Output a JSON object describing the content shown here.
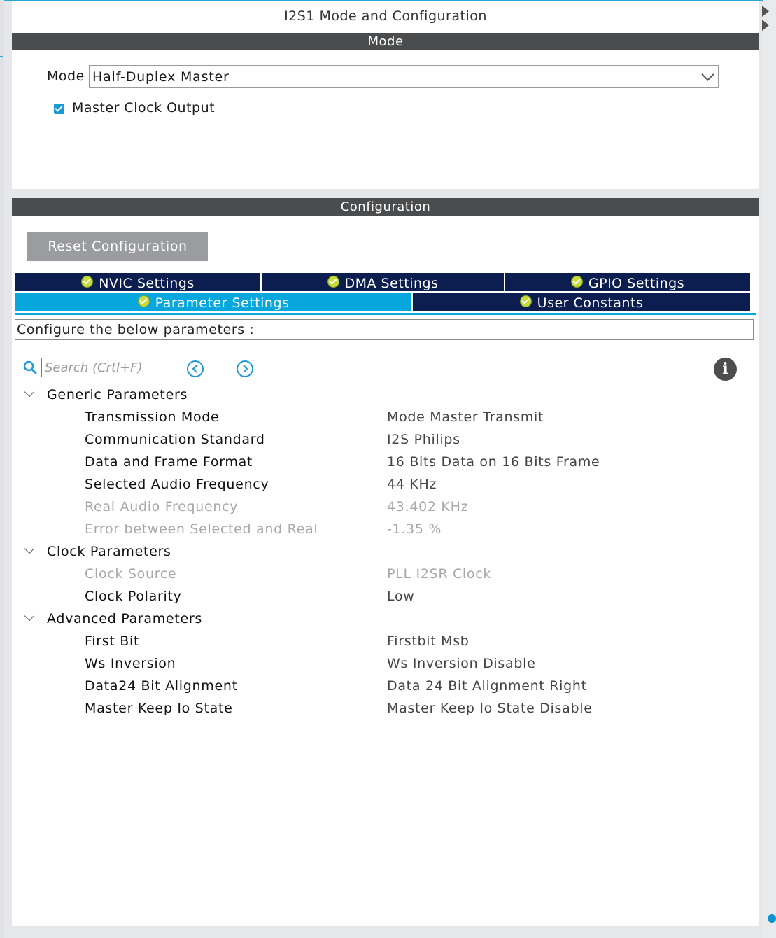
{
  "window": {
    "title": "I2S1 Mode and Configuration"
  },
  "mode_section": {
    "header": "Mode",
    "mode_label": "Mode",
    "mode_value": "Half-Duplex Master",
    "master_clock_output_label": "Master Clock Output",
    "master_clock_output_checked": true
  },
  "config_section": {
    "header": "Configuration",
    "reset_button": "Reset Configuration",
    "tabs_row1": [
      {
        "label": "NVIC Settings"
      },
      {
        "label": "DMA Settings"
      },
      {
        "label": "GPIO Settings"
      }
    ],
    "tabs_row2": [
      {
        "label": "Parameter Settings",
        "active": true
      },
      {
        "label": "User Constants"
      }
    ],
    "description": "Configure the below parameters :",
    "search_placeholder": "Search (Crtl+F)",
    "info_icon": "i"
  },
  "parameters": {
    "generic": {
      "title": "Generic Parameters",
      "items": [
        {
          "name": "Transmission Mode",
          "value": "Mode Master Transmit"
        },
        {
          "name": "Communication Standard",
          "value": "I2S Philips"
        },
        {
          "name": "Data and Frame Format",
          "value": "16 Bits Data on 16 Bits Frame"
        },
        {
          "name": "Selected Audio Frequency",
          "value": "44 KHz"
        },
        {
          "name": "Real Audio Frequency",
          "value": "43.402 KHz"
        },
        {
          "name": "Error between Selected and Real",
          "value": "-1.35 %"
        }
      ]
    },
    "clock": {
      "title": "Clock Parameters",
      "items": [
        {
          "name": "Clock Source",
          "value": "PLL I2SR Clock"
        },
        {
          "name": "Clock Polarity",
          "value": "Low"
        }
      ]
    },
    "advanced": {
      "title": "Advanced Parameters",
      "items": [
        {
          "name": "First Bit",
          "value": "Firstbit Msb"
        },
        {
          "name": "Ws Inversion",
          "value": "Ws Inversion Disable"
        },
        {
          "name": "Data24 Bit Alignment",
          "value": "Data 24 Bit Alignment Right"
        },
        {
          "name": "Master Keep Io State",
          "value": "Master Keep Io State Disable"
        }
      ]
    }
  },
  "colors": {
    "header_bar": "#4a4c4e",
    "tab_inactive": "#0b1e4f",
    "tab_active": "#07a6dc",
    "status_ok": "#c6db3c",
    "disabled_text": "#a8a8a8"
  }
}
